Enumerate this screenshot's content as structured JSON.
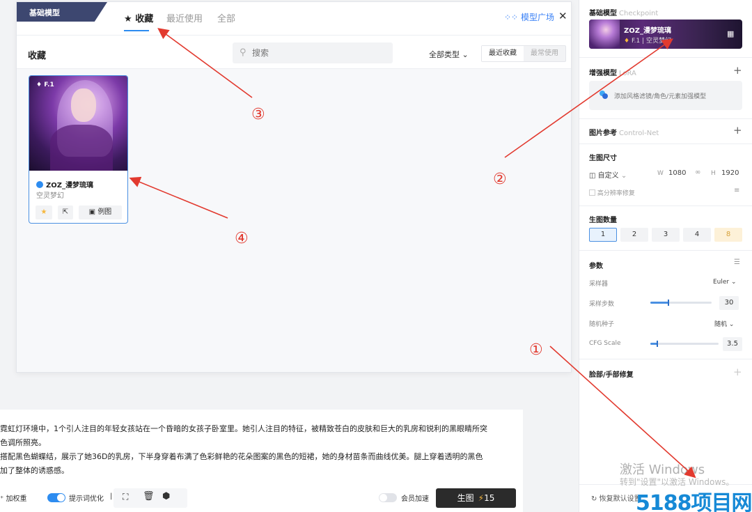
{
  "modal": {
    "base_tag": "基础模型",
    "tabs": [
      {
        "label": "收藏",
        "icon": "star-icon"
      },
      {
        "label": "最近使用"
      },
      {
        "label": "全部"
      }
    ],
    "plaza_label": "模型广场",
    "plaza_icon": "grid-icon",
    "close_icon": "close-icon",
    "section_title": "收藏",
    "search_placeholder": "搜索",
    "type_filter": "全部类型",
    "sort_options": [
      "最近收藏",
      "最常使用"
    ],
    "card": {
      "badge": "F.1",
      "name": "ZOZ_漫梦琉璃",
      "subtitle": "空灵梦幻",
      "btn_example": "例图"
    }
  },
  "panel": {
    "base_model": {
      "title": "基础模型",
      "en": "Checkpoint",
      "name": "ZOZ_漫梦琉璃",
      "meta": "F.1  |  空灵梦幻"
    },
    "lora": {
      "title": "增强模型",
      "en": "LoRA",
      "placeholder": "添加风格滤镜/角色/元素加强模型"
    },
    "controlnet": {
      "title": "图片参考",
      "en": "Control-Net"
    },
    "size": {
      "title": "生图尺寸",
      "preset": "自定义",
      "w_label": "W",
      "w": "1080",
      "h_label": "H",
      "h": "1920",
      "hires": "高分辨率修复"
    },
    "count": {
      "title": "生图数量",
      "options": [
        "1",
        "2",
        "3",
        "4",
        "8"
      ],
      "selected": 0
    },
    "params": {
      "title": "参数",
      "sampler_label": "采样器",
      "sampler": "Euler",
      "steps_label": "采样步数",
      "steps": "30",
      "steps_fraction": 0.3,
      "seed_label": "随机种子",
      "seed": "随机",
      "cfg_label": "CFG Scale",
      "cfg": "3.5",
      "cfg_fraction": 0.1
    },
    "face_fix": {
      "title": "脸部/手部修复"
    },
    "reset": "恢复默认设置",
    "watermark_1": "激活 Windows",
    "watermark_2": "转到\"设置\"以激活 Windows。",
    "brand": "5188项目网"
  },
  "prompt": {
    "lines": [
      "霓虹灯环境中，1个引人注目的年轻女孩站在一个昏暗的女孩子卧室里。她引人注目的特征，被精致苍白的皮肤和巨大的乳房和锐利的黑眼睛所突",
      "色调所照亮。",
      "搭配黑色蝴蝶结，展示了她36D的乳房，下半身穿着布满了色彩鲜艳的花朵图案的黑色的短裙，她的身材苗条而曲线优美。腿上穿着透明的黑色",
      "加了整体的诱惑感。"
    ],
    "add_weight": "加权重",
    "optimize": "提示词优化",
    "optimize_on": true,
    "vip_speed": "会员加速",
    "vip_speed_on": false,
    "generate": "生图",
    "generate_cost": "15"
  },
  "annotations": [
    "①",
    "②",
    "③",
    "④"
  ],
  "colors": {
    "accent": "#2d8cf0",
    "annotation": "#e23a2f",
    "generate_bg": "#2b2b2b"
  }
}
